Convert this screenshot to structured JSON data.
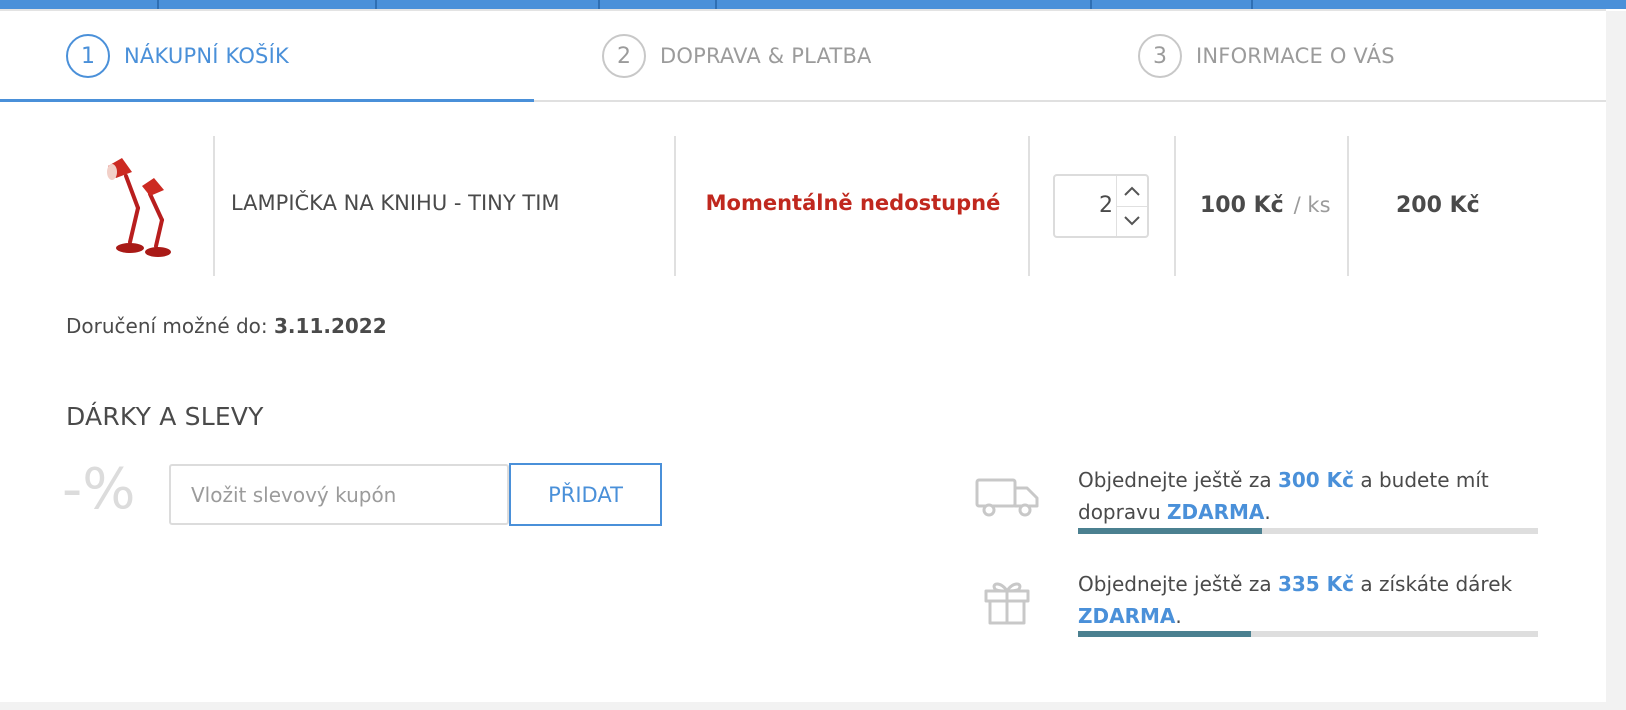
{
  "steps": [
    {
      "number": "1",
      "label": "NÁKUPNÍ KOŠÍK",
      "active": true
    },
    {
      "number": "2",
      "label": "DOPRAVA & PLATBA",
      "active": false
    },
    {
      "number": "3",
      "label": "INFORMACE O VÁS",
      "active": false
    }
  ],
  "cart": {
    "item": {
      "name": "LAMPIČKA NA KNIHU - TINY TIM",
      "availability": "Momentálně nedostupné",
      "quantity": "2",
      "unit_price": "100 Kč",
      "unit_suffix": "/ ks",
      "total": "200 Kč"
    }
  },
  "delivery": {
    "label": "Doručení možné do:",
    "date": "3.11.2022"
  },
  "gifts": {
    "title": "DÁRKY A SLEVY",
    "percent_symbol": "-%",
    "coupon_placeholder": "Vložit slevový kupón",
    "add_label": "PŘIDAT"
  },
  "promos": [
    {
      "icon": "truck-icon",
      "prefix": "Objednejte ještě za",
      "amount": "300 Kč",
      "middle": "a budete mít dopravu",
      "free": "ZDARMA",
      "end": ".",
      "progress": 0.4
    },
    {
      "icon": "gift-icon",
      "prefix": "Objednejte ještě za",
      "amount": "335 Kč",
      "middle": "a získáte dárek",
      "free": "ZDARMA",
      "end": ".",
      "progress": 0.375
    }
  ],
  "colors": {
    "accent": "#4a90d9",
    "unavailable": "#c0281e",
    "progress": "#4b8090"
  }
}
